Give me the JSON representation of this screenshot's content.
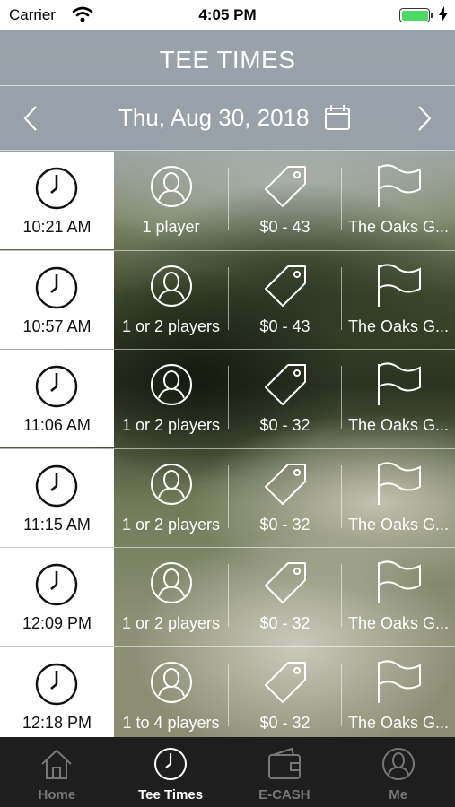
{
  "status_bar": {
    "carrier": "Carrier",
    "time": "4:05 PM"
  },
  "header": {
    "title": "TEE TIMES"
  },
  "date_nav": {
    "date": "Thu, Aug 30, 2018"
  },
  "tee_times": [
    {
      "time": "10:21 AM",
      "players": "1 player",
      "price": "$0 - 43",
      "course": "The Oaks G..."
    },
    {
      "time": "10:57 AM",
      "players": "1 or 2 players",
      "price": "$0 - 43",
      "course": "The Oaks G..."
    },
    {
      "time": "11:06 AM",
      "players": "1 or 2 players",
      "price": "$0 - 32",
      "course": "The Oaks G..."
    },
    {
      "time": "11:15 AM",
      "players": "1 or 2 players",
      "price": "$0 - 32",
      "course": "The Oaks G..."
    },
    {
      "time": "12:09 PM",
      "players": "1 or 2 players",
      "price": "$0 - 32",
      "course": "The Oaks G..."
    },
    {
      "time": "12:18 PM",
      "players": "1 to 4 players",
      "price": "$0 - 32",
      "course": "The Oaks G..."
    }
  ],
  "tabs": [
    {
      "label": "Home",
      "icon": "home-icon",
      "active": false
    },
    {
      "label": "Tee Times",
      "icon": "clock-icon",
      "active": true
    },
    {
      "label": "E-CASH",
      "icon": "wallet-icon",
      "active": false
    },
    {
      "label": "Me",
      "icon": "user-icon",
      "active": false
    }
  ],
  "colors": {
    "battery": "#4cd964",
    "tab_bar": "#1e1e1e",
    "tab_active": "#ffffff",
    "tab_inactive": "#777777"
  }
}
